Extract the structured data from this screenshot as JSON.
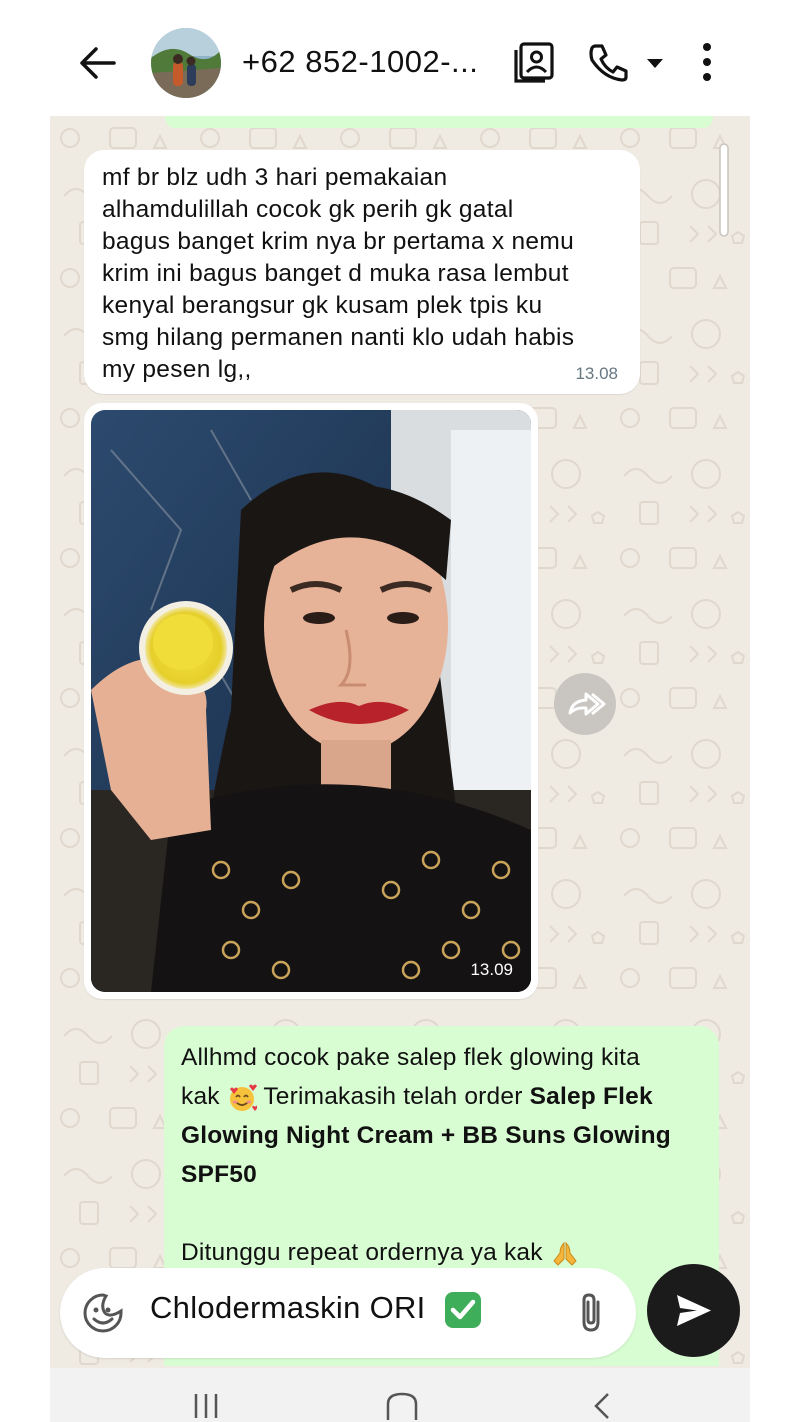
{
  "header": {
    "contact_name": "+62 852-1002-...",
    "icons": [
      "back-arrow-icon",
      "contact-avatar",
      "contact-card-icon",
      "phone-icon",
      "dropdown-caret-icon",
      "more-vertical-icon"
    ]
  },
  "messages": {
    "incoming_text": "mf br blz udh 3 hari pemakaian\nalhamdulillah cocok gk perih gk gatal\nbagus banget krim nya br pertama x nemu\nkrim ini bagus banget d muka rasa lembut\nkenyal berangsur gk kusam plek tpis ku\nsmg hilang permanen nanti klo udah habis\nmy pesen lg,,",
    "incoming_time": "13.08",
    "image_time": "13.09",
    "outgoing": {
      "line1": "Allhmd cocok pake salep flek glowing kita",
      "line2_prefix": "kak",
      "line2_after_emoji": " Terimakasih telah order ",
      "product_bold": "Salep Flek Glowing Night Cream + BB Suns Glowing SPF50",
      "closing": "Ditunggu repeat ordernya ya kak"
    }
  },
  "composer": {
    "input_value": "Chlodermaskin ORI"
  },
  "colors": {
    "chat_background": "#efeae2",
    "outgoing_bubble": "#d9fdd3",
    "incoming_bubble": "#ffffff",
    "send_button": "#1b1b1b",
    "time_text": "#667781"
  }
}
